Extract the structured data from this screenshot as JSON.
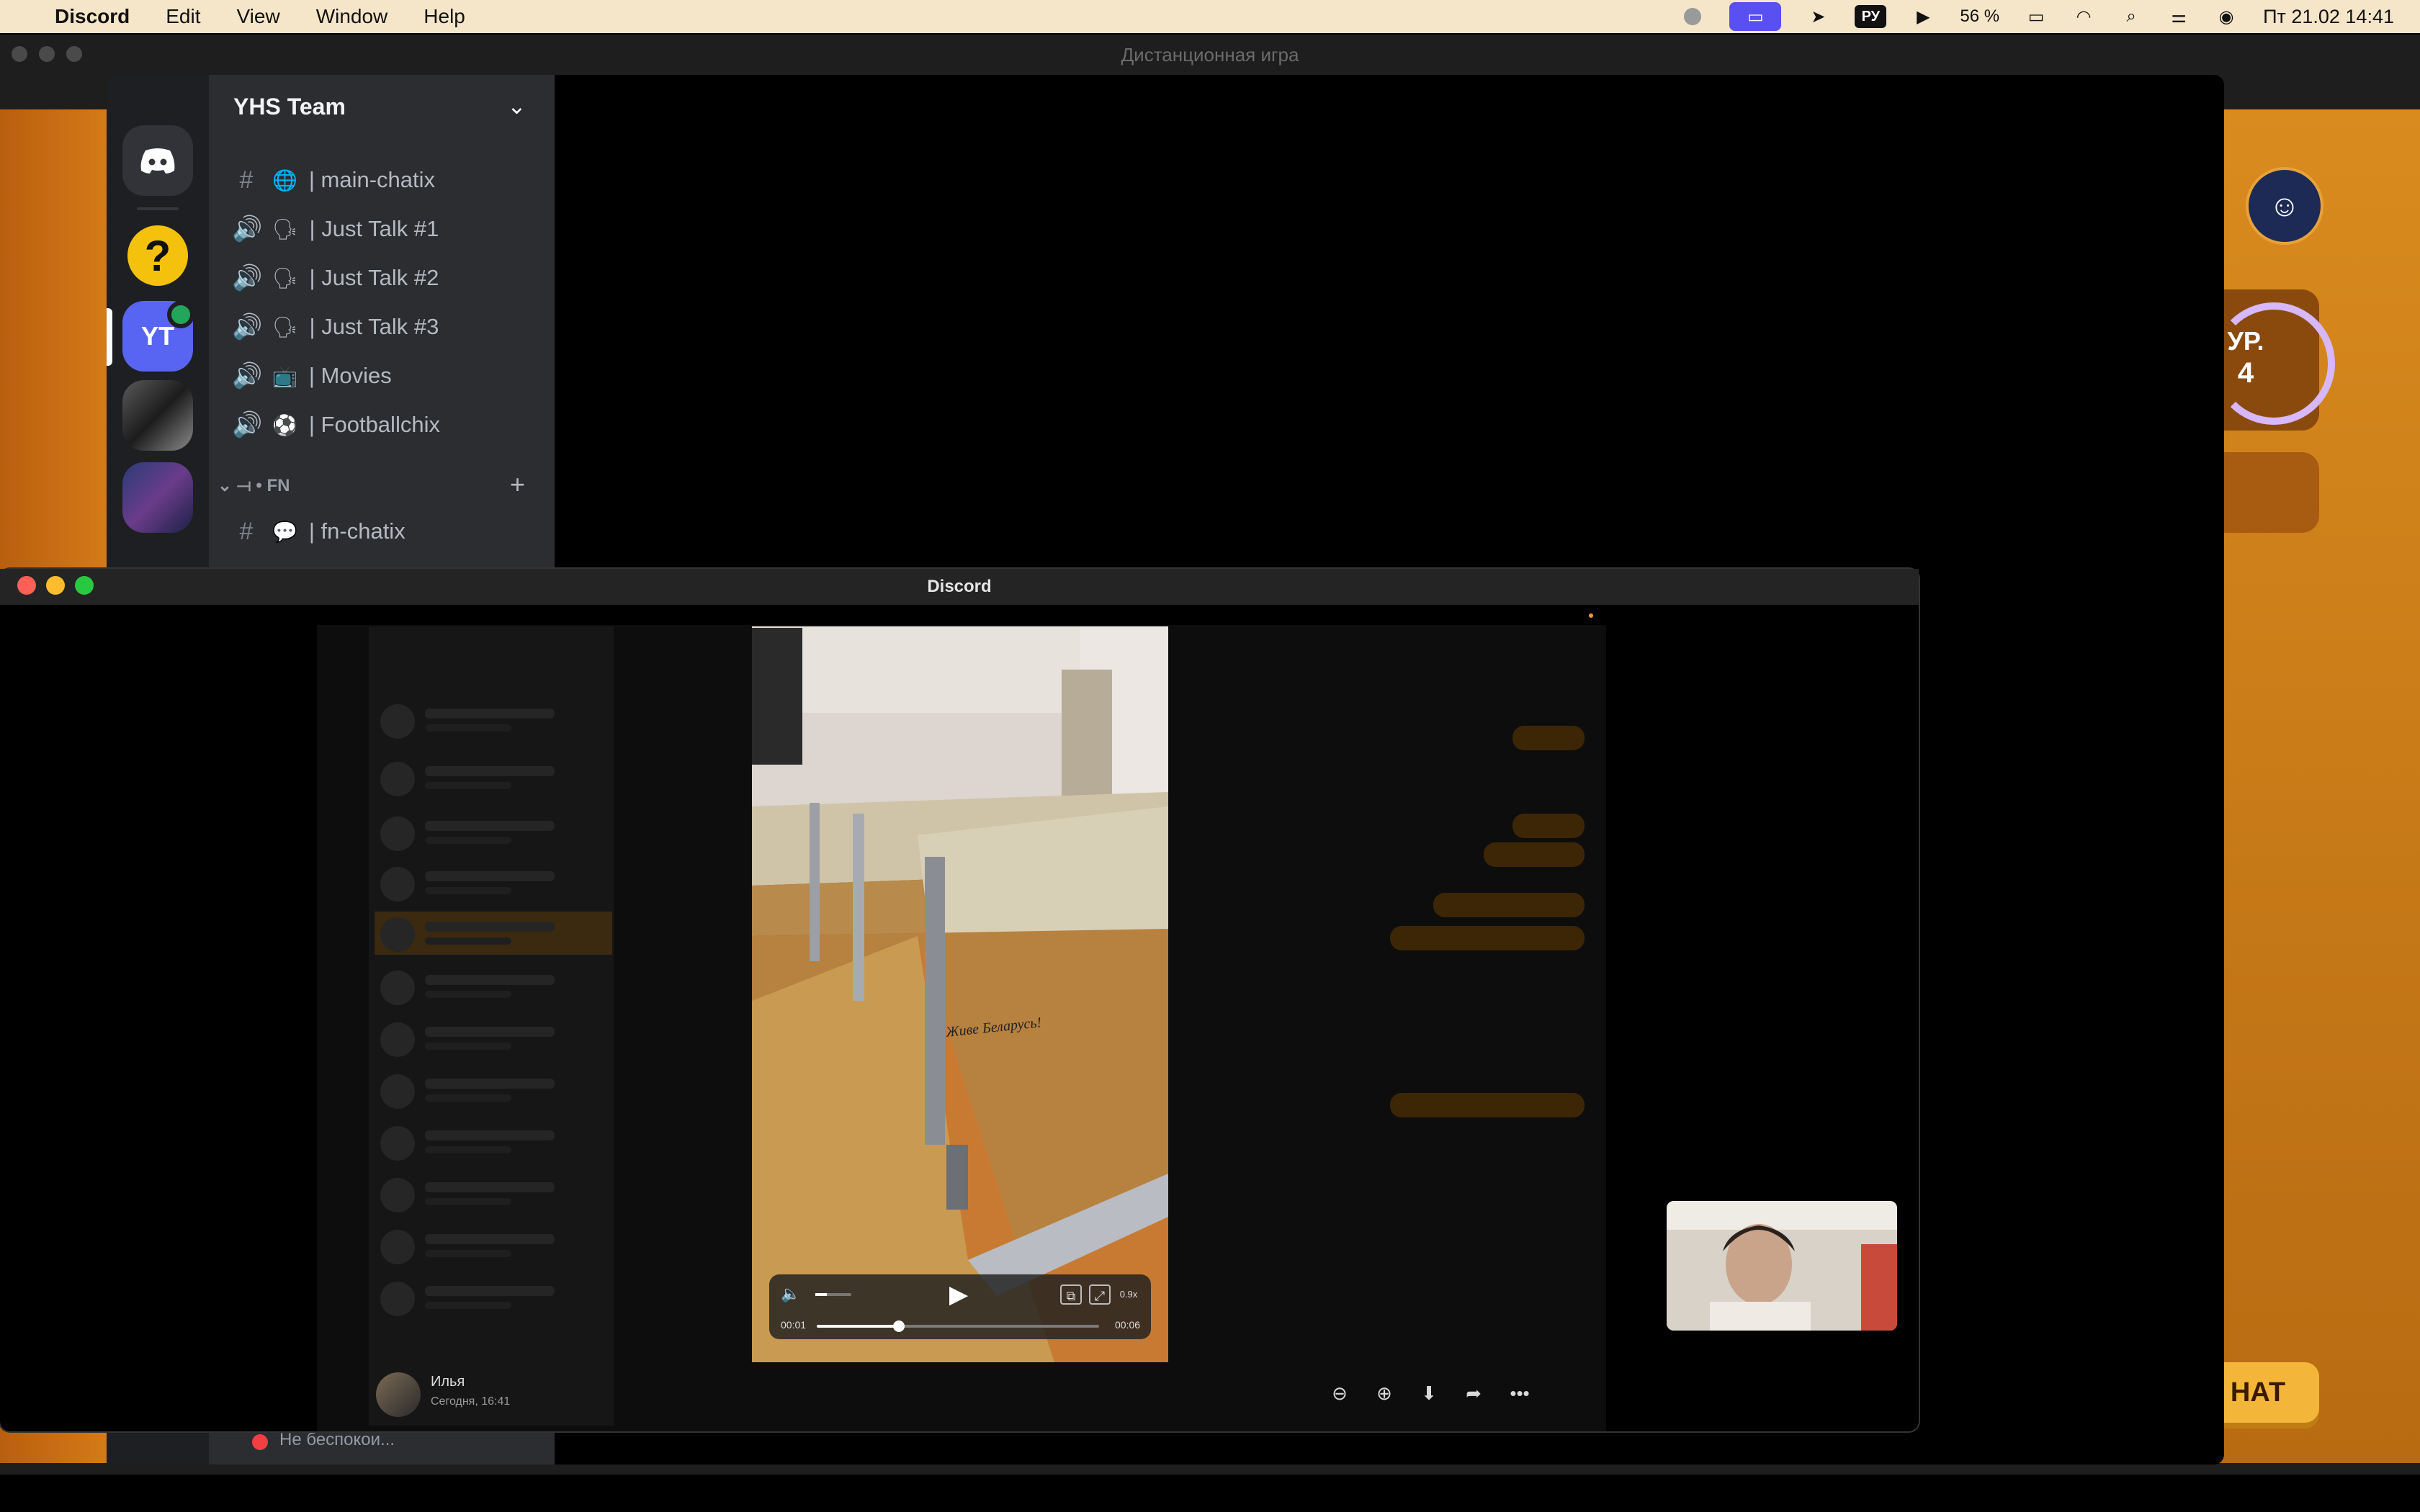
{
  "menubar": {
    "app": "Discord",
    "items": [
      "Edit",
      "View",
      "Window",
      "Help"
    ],
    "keyboard": "РУ",
    "battery": "56 %",
    "datetime": "Пт 21.02  14:41"
  },
  "background_window": {
    "title": "Дистанционная игра",
    "level_label": "УР.",
    "level_value": "4",
    "chat_button": "НАТ"
  },
  "discord": {
    "server_name": "YHS Team",
    "servers": [
      {
        "label": "",
        "icon": "discord-logo-icon"
      },
      {
        "label": "?",
        "icon": "help-icon"
      },
      {
        "label": "YT",
        "icon": "yt-server"
      },
      {
        "label": "",
        "icon": "server-image-1"
      },
      {
        "label": "",
        "icon": "server-image-2"
      }
    ],
    "channels": [
      {
        "type": "text",
        "emoji": "🌐",
        "name": "| main-chatix"
      },
      {
        "type": "voice",
        "emoji": "🗣",
        "name": "| Just Talk #1"
      },
      {
        "type": "voice",
        "emoji": "🗣",
        "name": "| Just Talk #2"
      },
      {
        "type": "voice",
        "emoji": "🗣",
        "name": "| Just Talk #3"
      },
      {
        "type": "voice",
        "emoji": "📺",
        "name": "| Movies"
      },
      {
        "type": "voice",
        "emoji": "⚽",
        "name": "| Footballchix"
      }
    ],
    "category": {
      "name": "FN"
    },
    "category_channels": [
      {
        "type": "text",
        "emoji": "💬",
        "name": "| fn-chatix"
      }
    ],
    "user_status": "Не беспокои..."
  },
  "media_viewer": {
    "title": "Discord",
    "video": {
      "current_time": "00:01",
      "duration": "00:06",
      "progress": 0.29,
      "speed": "0.9x",
      "handwriting": "Живе Беларусь!"
    },
    "sender": {
      "name": "Илья",
      "time": "Сегодня, 16:41"
    },
    "toolbar": [
      "zoom-out-icon",
      "zoom-in-icon",
      "download-icon",
      "share-icon",
      "more-icon"
    ]
  },
  "colors": {
    "menubar_bg": "#f6e6c9",
    "discord_blurple": "#5865f2",
    "game_orange": "#d67a18"
  }
}
